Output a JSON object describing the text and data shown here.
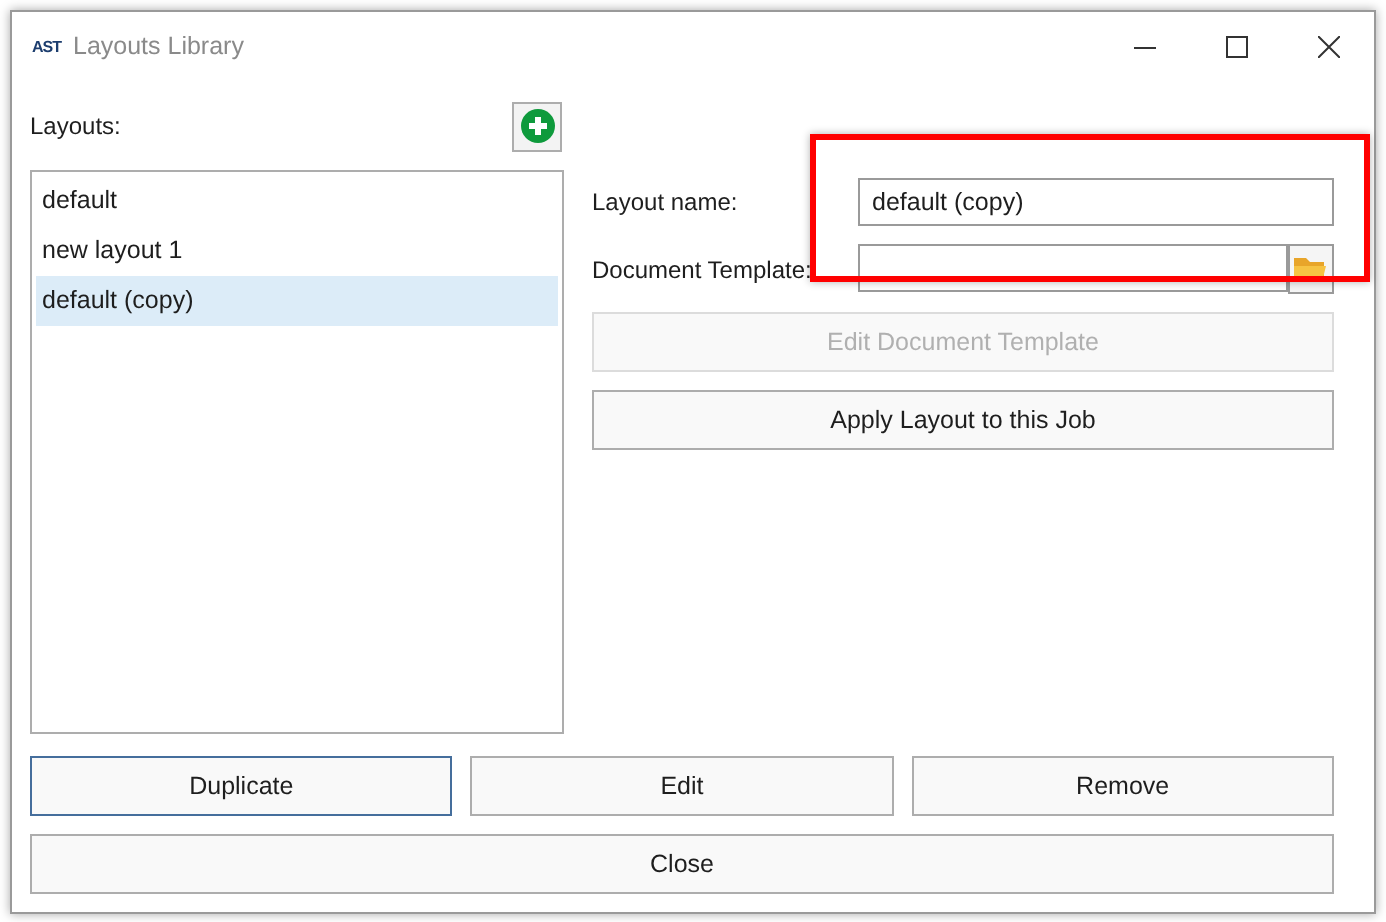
{
  "window": {
    "logo": "AST",
    "title": "Layouts Library"
  },
  "layouts": {
    "label": "Layouts:",
    "items": [
      {
        "name": "default",
        "selected": false
      },
      {
        "name": "new layout 1",
        "selected": false
      },
      {
        "name": "default (copy)",
        "selected": true
      }
    ]
  },
  "details": {
    "name_label": "Layout name:",
    "name_value": "default (copy)",
    "template_label": "Document Template:",
    "edit_template": {
      "label": "Edit Document Template",
      "disabled": true
    },
    "apply": {
      "label": "Apply Layout to this Job",
      "disabled": false
    }
  },
  "buttons": [
    {
      "label": "Duplicate",
      "focused": true
    },
    {
      "label": "Edit",
      "focused": false
    },
    {
      "label": "Remove",
      "focused": false
    }
  ],
  "close": "Close"
}
